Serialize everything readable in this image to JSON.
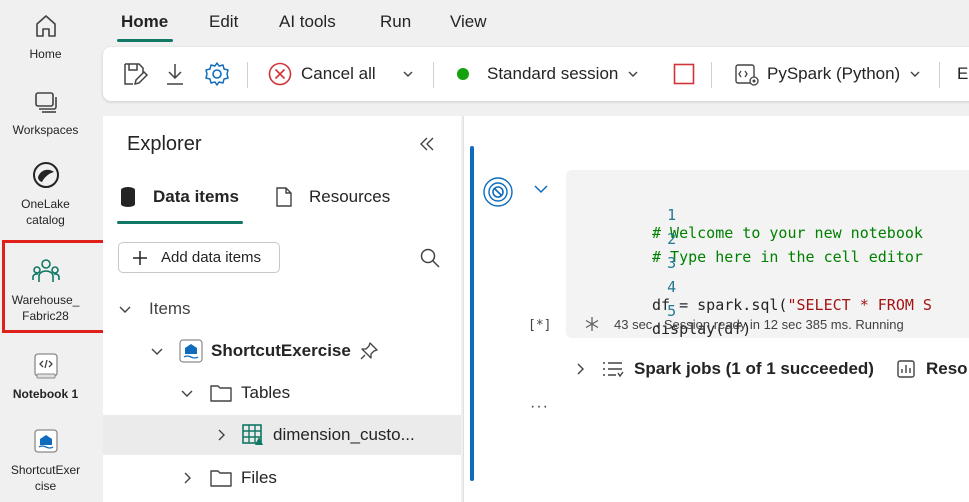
{
  "rail": {
    "items": [
      {
        "label": "Home",
        "icon": "home-icon"
      },
      {
        "label": "Workspaces",
        "icon": "workspaces-icon"
      },
      {
        "label": "OneLake\ncatalog",
        "icon": "onelake-catalog-icon"
      },
      {
        "label": "Warehouse_\nFabric28",
        "icon": "workspace-people-icon"
      },
      {
        "label": "Notebook 1",
        "icon": "notebook-icon"
      },
      {
        "label": "ShortcutExer\ncise",
        "icon": "lakehouse-icon"
      }
    ],
    "highlight_color": "#e0201b"
  },
  "tabs": [
    "Home",
    "Edit",
    "AI tools",
    "Run",
    "View"
  ],
  "ribbon": {
    "cancel_all": "Cancel all",
    "session": "Standard session",
    "language": "PySpark (Python)",
    "overflow": "En",
    "session_dot_color": "#13a10e"
  },
  "explorer": {
    "title": "Explorer",
    "tab_data_items": "Data items",
    "tab_resources": "Resources",
    "add_button": "Add data items",
    "section_items": "Items",
    "lakehouse": "ShortcutExercise",
    "tables": "Tables",
    "table_item": "dimension_custo...",
    "files": "Files"
  },
  "cell": {
    "lines": [
      {
        "n": "1",
        "text": "# Welcome to your new notebook"
      },
      {
        "n": "2",
        "text": "# Type here in the cell editor"
      },
      {
        "n": "3",
        "text": ""
      },
      {
        "n": "4",
        "text_pre": "df = spark.sql(",
        "text_str": "\"SELECT * FROM S"
      },
      {
        "n": "5",
        "text": "display(df)"
      }
    ],
    "exec_count": "[*]",
    "status": "43 sec - Session ready in 12 sec 385 ms. Running",
    "spark_jobs": "Spark jobs (1 of 1 succeeded)",
    "resources_cut": "Reso",
    "more": "···"
  },
  "colors": {
    "accent_green": "#117865",
    "accent_blue": "#0f6cbd"
  }
}
